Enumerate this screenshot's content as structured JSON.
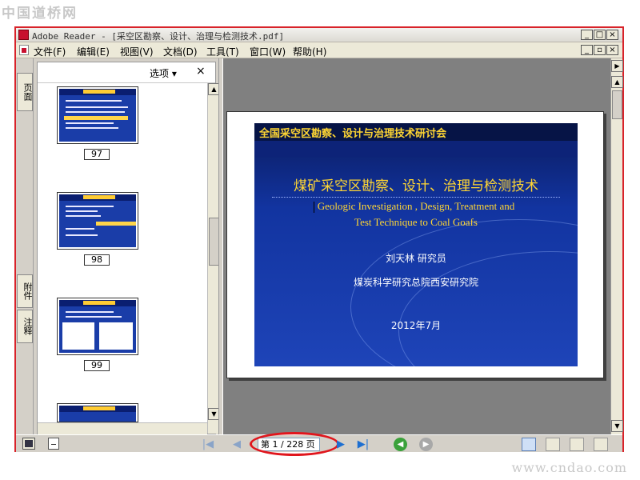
{
  "watermarks": {
    "top": "中国道桥网",
    "bottom": "www.cndao.com"
  },
  "window": {
    "title": "Adobe Reader - [采空区勘察、设计、治理与检测技术.pdf]",
    "buttons": {
      "minimize": "_",
      "maximize": "□",
      "close": "×",
      "restore": "▫"
    }
  },
  "menu": [
    {
      "label": "文件(F)"
    },
    {
      "label": "编辑(E)"
    },
    {
      "label": "视图(V)"
    },
    {
      "label": "文档(D)"
    },
    {
      "label": "工具(T)"
    },
    {
      "label": "窗口(W)"
    },
    {
      "label": "帮助(H)"
    }
  ],
  "side_tabs": {
    "pages": "页面",
    "attachments": "附件",
    "comments": "注释"
  },
  "nav_panel": {
    "options_label": "选项 ▾",
    "close_label": "×",
    "thumbnails": [
      {
        "page": "97"
      },
      {
        "page": "98"
      },
      {
        "page": "99"
      }
    ]
  },
  "slide": {
    "header": "全国采空区勘察、设计与治理技术研讨会",
    "title": "煤矿采空区勘察、设计、治理与检测技术",
    "subtitle_line1": "Geologic Investigation , Design, Treatment and",
    "subtitle_line2": "Test Technique to Coal  Goafs",
    "author": "刘天林   研究员",
    "institute": "煤炭科学研究总院西安研究院",
    "date": "2012年7月"
  },
  "statusbar": {
    "page_field": "第 1 / 228 页",
    "first_page_icon": "|◀",
    "prev_page_icon": "◀",
    "next_page_icon": "▶",
    "last_page_icon": "▶|",
    "back_icon": "◀",
    "forward_icon": "▶"
  },
  "colors": {
    "accent_red": "#d8232a",
    "slide_blue": "#1e44b8",
    "slide_gold": "#ffd633"
  }
}
